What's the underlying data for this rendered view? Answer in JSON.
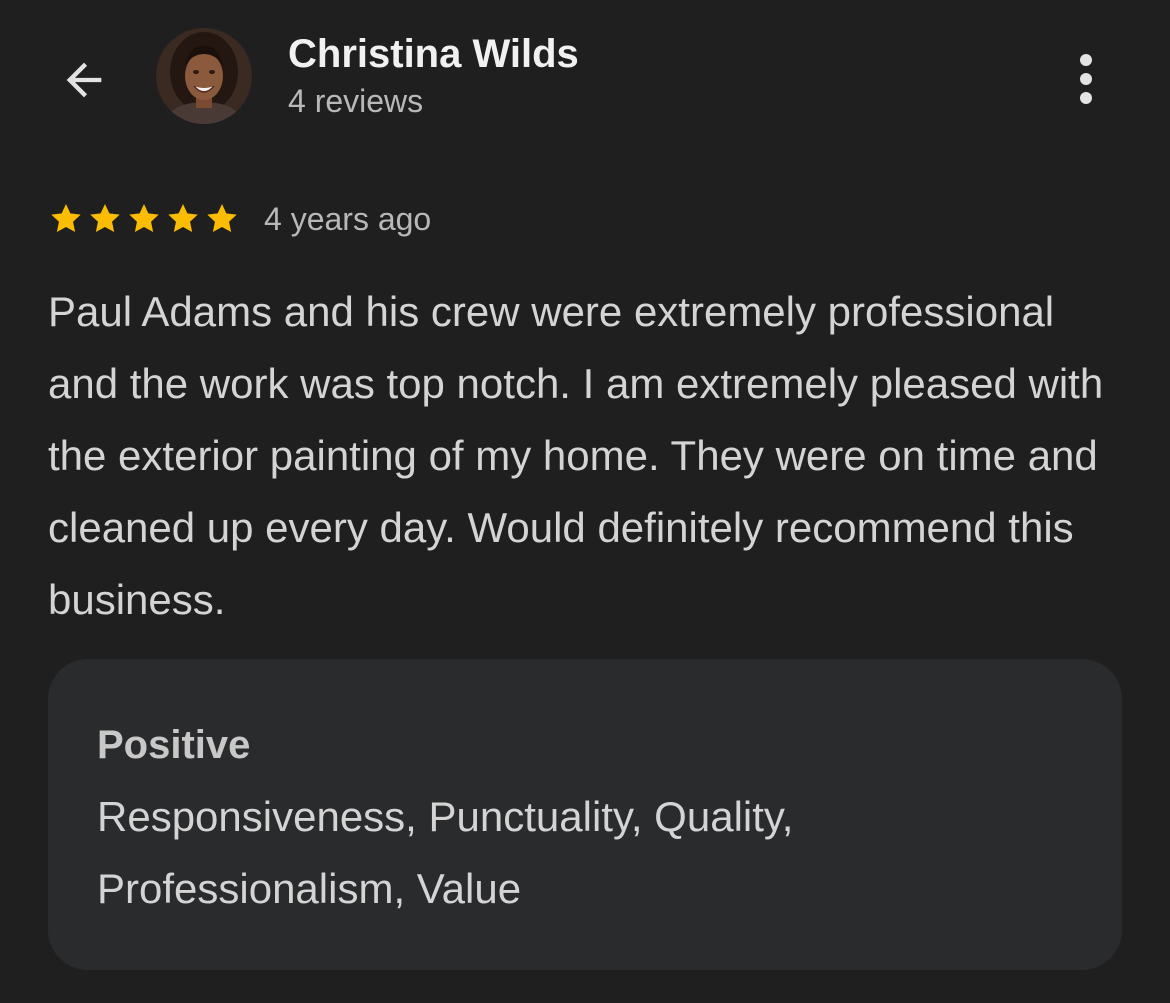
{
  "header": {
    "back_icon": "arrow-left-icon",
    "reviewer_name": "Christina Wilds",
    "review_count": "4 reviews",
    "more_icon": "more-vertical-icon"
  },
  "review": {
    "rating": 5,
    "max_rating": 5,
    "time_ago": "4 years ago",
    "text": "Paul Adams and his crew were extremely professional and the work was top notch. I am extremely pleased with the exterior painting of my home. They were on time and cleaned up every day. Would definitely recommend this business."
  },
  "feedback": {
    "title": "Positive",
    "text": "Responsiveness, Punctuality, Quality, Professionalism, Value"
  },
  "colors": {
    "background": "#1f1f1f",
    "card": "#2a2b2d",
    "star": "#fbbc04",
    "text_primary": "#f1f1f1",
    "text_secondary": "#b8b8b8"
  }
}
